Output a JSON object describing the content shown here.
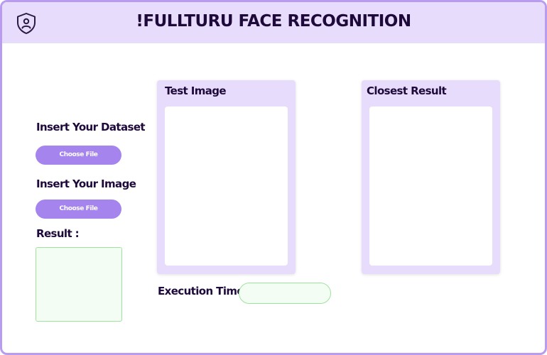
{
  "header": {
    "title": "!FULLTURU FACE RECOGNITION",
    "logo_icon": "shield-face-icon"
  },
  "sidebar": {
    "dataset_label": "Insert Your Dataset",
    "dataset_button": "Choose File",
    "image_label": "Insert Your Image",
    "image_button": "Choose File",
    "result_label": "Result :",
    "result_value": ""
  },
  "test_panel": {
    "title": "Test Image"
  },
  "closest_panel": {
    "title": "Closest Result"
  },
  "execution": {
    "label": "Execution Time :",
    "value": ""
  },
  "colors": {
    "accent": "#a584ee",
    "header_bg": "#e8dcfc",
    "border": "#b99cf0",
    "text_dark": "#1e0a3a",
    "result_green": "#9ee39e"
  }
}
